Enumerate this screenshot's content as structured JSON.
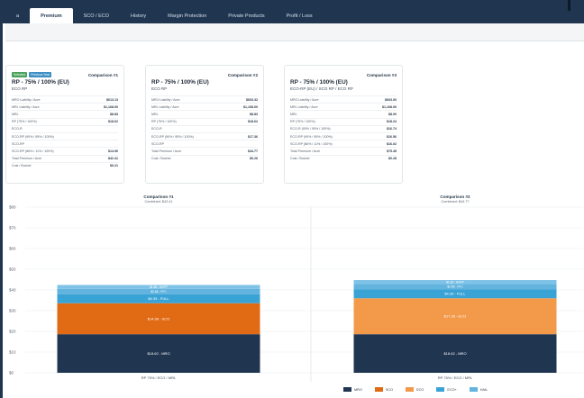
{
  "tabs": [
    {
      "label": "a"
    },
    {
      "label": "Premium"
    },
    {
      "label": "SCO / ECO"
    },
    {
      "label": "History"
    },
    {
      "label": "Margin Protection"
    },
    {
      "label": "Private Products"
    },
    {
      "label": "Profit / Loss"
    }
  ],
  "cards": [
    {
      "title": "Comparison #1",
      "badges": [
        "Selected",
        "Previous Year"
      ],
      "plan": "RP - 75% / 100% (EU)",
      "sub": "ECO RP",
      "rows": [
        {
          "label": "MRO Liability / Acre",
          "value": "$613.13"
        },
        {
          "label": "MRL Liability / Acre",
          "value": "$1,168.00"
        },
        {
          "label": "MRL",
          "value": "$8.83"
        },
        {
          "label": "RP (75% / 100%)",
          "value": "$18.62"
        },
        {
          "label": "ECO-R",
          "value": ""
        },
        {
          "label": "ECO-RP (90% / 95% / 100%)",
          "value": ""
        },
        {
          "label": "SCO-RP",
          "value": ""
        },
        {
          "label": "SCO-RP (86% / 11% / 100%)",
          "value": "$14.96"
        },
        {
          "label": "Total Premium / Acre",
          "value": "$42.41"
        },
        {
          "label": "Cost / Bushel",
          "value": "$0.21"
        }
      ]
    },
    {
      "title": "Comparison #2",
      "badges": [],
      "plan": "RP - 75% / 100% (EU)",
      "sub": "ECO RP",
      "rows": [
        {
          "label": "MRO Liability / Acre",
          "value": "$603.32"
        },
        {
          "label": "MRL Liability / Acre",
          "value": "$1,168.00"
        },
        {
          "label": "MRL",
          "value": "$8.83"
        },
        {
          "label": "RP (75% / 100%)",
          "value": "$18.62"
        },
        {
          "label": "ECO-R",
          "value": ""
        },
        {
          "label": "ECO-RP (90% / 95% / 100%)",
          "value": "$17.36"
        },
        {
          "label": "SCO-RP",
          "value": ""
        },
        {
          "label": "Total Premium / Acre",
          "value": "$44.77"
        },
        {
          "label": "Cost / Bushel",
          "value": "$0.26"
        }
      ]
    },
    {
      "title": "Comparison #3",
      "badges": [],
      "plan": "RP - 75% / 100% (EU)",
      "sub": "ECO-RP (EU) / SCO RP / ECO RP",
      "rows": [
        {
          "label": "MRO Liability / Acre",
          "value": "$603.00"
        },
        {
          "label": "MRL Liability / Acre",
          "value": "$1,168.00"
        },
        {
          "label": "MRL",
          "value": "$8.00"
        },
        {
          "label": "RP (75% / 100%)",
          "value": "$18.24"
        },
        {
          "label": "ECO-R (90% / 95% / 100%)",
          "value": "$16.74"
        },
        {
          "label": "ECO-RP (90% / 95% / 100%)",
          "value": "$16.56"
        },
        {
          "label": "SCO-RP (86% / 11% / 100%)",
          "value": "$16.02"
        },
        {
          "label": "Total Premium / Acre",
          "value": "$75.45"
        },
        {
          "label": "Cost / Bushel",
          "value": "$0.28"
        }
      ]
    }
  ],
  "chart_data": {
    "type": "bar",
    "stacked": true,
    "ylim": [
      0,
      80
    ],
    "yticks": [
      "$0",
      "$10",
      "$20",
      "$30",
      "$40",
      "$50",
      "$60",
      "$70",
      "$80"
    ],
    "categories": [
      "RP 75% / ECO / MRL",
      "RP 75% / ECO / MRL"
    ],
    "panels": [
      {
        "title": "Comparison #1",
        "subtitle": "Combined: $42.41"
      },
      {
        "title": "Comparison #2",
        "subtitle": "Combined: $44.77"
      }
    ],
    "series": [
      {
        "name": "MRO",
        "color": "#1f3550",
        "values": [
          18.62,
          18.62
        ],
        "labels": [
          "$18.62 - MRO",
          "$18.62 - MRO"
        ]
      },
      {
        "name": "SCO",
        "color": "#e06b14",
        "values": [
          14.96,
          0
        ],
        "labels": [
          "$14.96 - SCO",
          ""
        ]
      },
      {
        "name": "ECO",
        "color": "#f29a4a",
        "values": [
          0,
          17.36
        ],
        "labels": [
          "",
          "$17.36 - ECO"
        ]
      },
      {
        "name": "ECO+",
        "color": "#3aa3d6",
        "values": [
          4.39,
          4.39
        ],
        "labels": [
          "$4.39 - FULL",
          "$4.39 - FULL"
        ]
      },
      {
        "name": "HAIL",
        "color": "#62b3de",
        "values": [
          2.58,
          2.58
        ],
        "labels": [
          "$2.58 - FFC",
          "$2.58 - FFC"
        ]
      },
      {
        "name": "",
        "color": "#7ec3e7",
        "values": [
          1.86,
          1.82
        ],
        "labels": [
          "$1.86 - BXFP",
          "$1.82 - BXFP"
        ]
      }
    ],
    "legend": [
      "MRO",
      "SCO",
      "ECO",
      "ECO+",
      "HAIL"
    ],
    "legend_position": "bottom-right",
    "grid": true
  }
}
